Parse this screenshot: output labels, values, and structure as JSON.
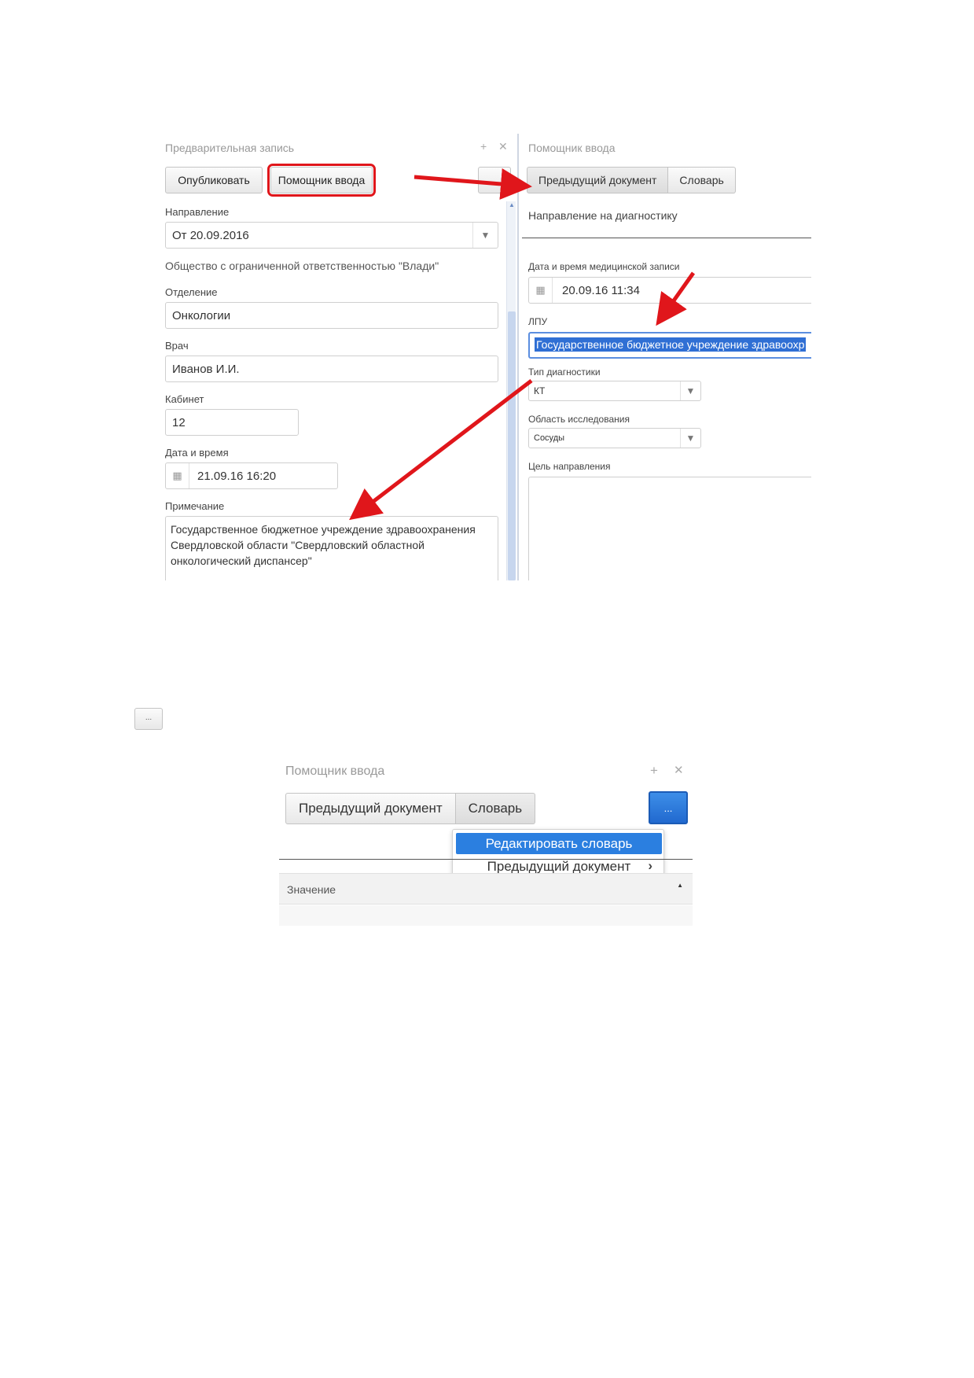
{
  "top_left_panel": {
    "title": "Предварительная запись",
    "publish_button": "Опубликовать",
    "input_helper_button": "Помощник ввода",
    "direction_label": "Направление",
    "direction_value": "От 20.09.2016",
    "organization_text": "Общество с ограниченной ответственностью \"Влади\"",
    "department_label": "Отделение",
    "department_value": "Онкологии",
    "doctor_label": "Врач",
    "doctor_value": "Иванов И.И.",
    "cabinet_label": "Кабинет",
    "cabinet_value": "12",
    "datetime_label": "Дата и время",
    "datetime_value": "21.09.16 16:20",
    "note_label": "Примечание",
    "note_value": "Государственное бюджетное учреждение здравоохранения Свердловской области \"Свердловский областной онкологический диспансер\""
  },
  "top_right_panel": {
    "title": "Помощник ввода",
    "tab_previous": "Предыдущий документ",
    "tab_dictionary": "Словарь",
    "doc_title": "Направление на диагностику",
    "record_datetime_label": "Дата и время медицинской записи",
    "record_datetime_value": "20.09.16 11:34",
    "lpu_label": "ЛПУ",
    "lpu_value": "Государственное бюджетное учреждение здравоохр",
    "diag_type_label": "Тип диагностики",
    "diag_type_value": "КТ",
    "area_label": "Область исследования",
    "area_value": "Сосуды",
    "purpose_label": "Цель направления"
  },
  "ellipsis_button": "...",
  "bottom_panel": {
    "title": "Помощник ввода",
    "tab_previous": "Предыдущий документ",
    "tab_dictionary": "Словарь",
    "menu_button": "...",
    "menu_items": [
      "Редактировать словарь",
      "Предыдущий документ"
    ],
    "column_header": "Значение"
  },
  "colors": {
    "highlight_red": "#e0161b",
    "selection_blue": "#2f6fd4",
    "menu_active": "#2b7fe0"
  }
}
